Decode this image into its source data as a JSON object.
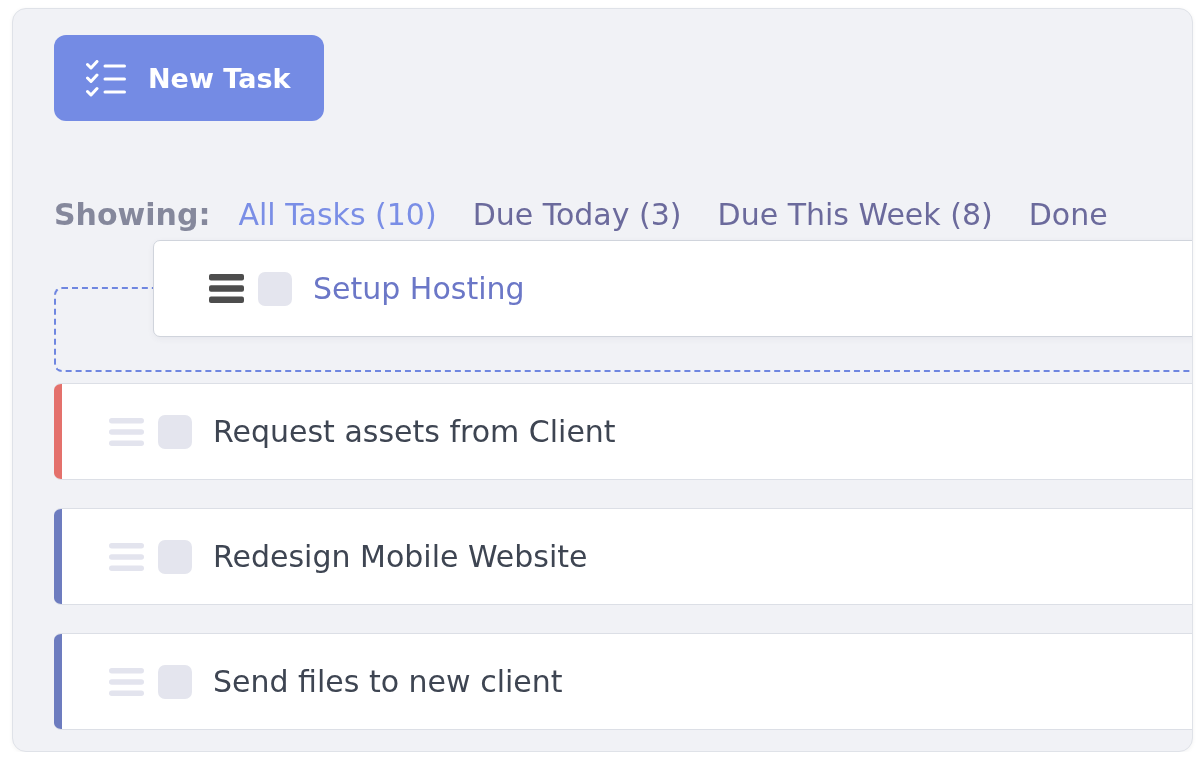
{
  "new_task_button": {
    "label": "New Task"
  },
  "filter_bar": {
    "label": "Showing:",
    "tabs": [
      {
        "label": "All Tasks (10)",
        "selected": true
      },
      {
        "label": "Due Today (3)",
        "selected": false
      },
      {
        "label": "Due This Week (8)",
        "selected": false
      },
      {
        "label": "Done",
        "selected": false
      }
    ]
  },
  "dragged_task": {
    "title": "Setup Hosting",
    "checked": false
  },
  "tasks": [
    {
      "title": "Request assets from Client",
      "checked": false,
      "color": "#e4716c"
    },
    {
      "title": "Redesign Mobile Website",
      "checked": false,
      "color": "#6d7cbf"
    },
    {
      "title": "Send files to new client",
      "checked": false,
      "color": "#6d7cbf"
    }
  ]
}
